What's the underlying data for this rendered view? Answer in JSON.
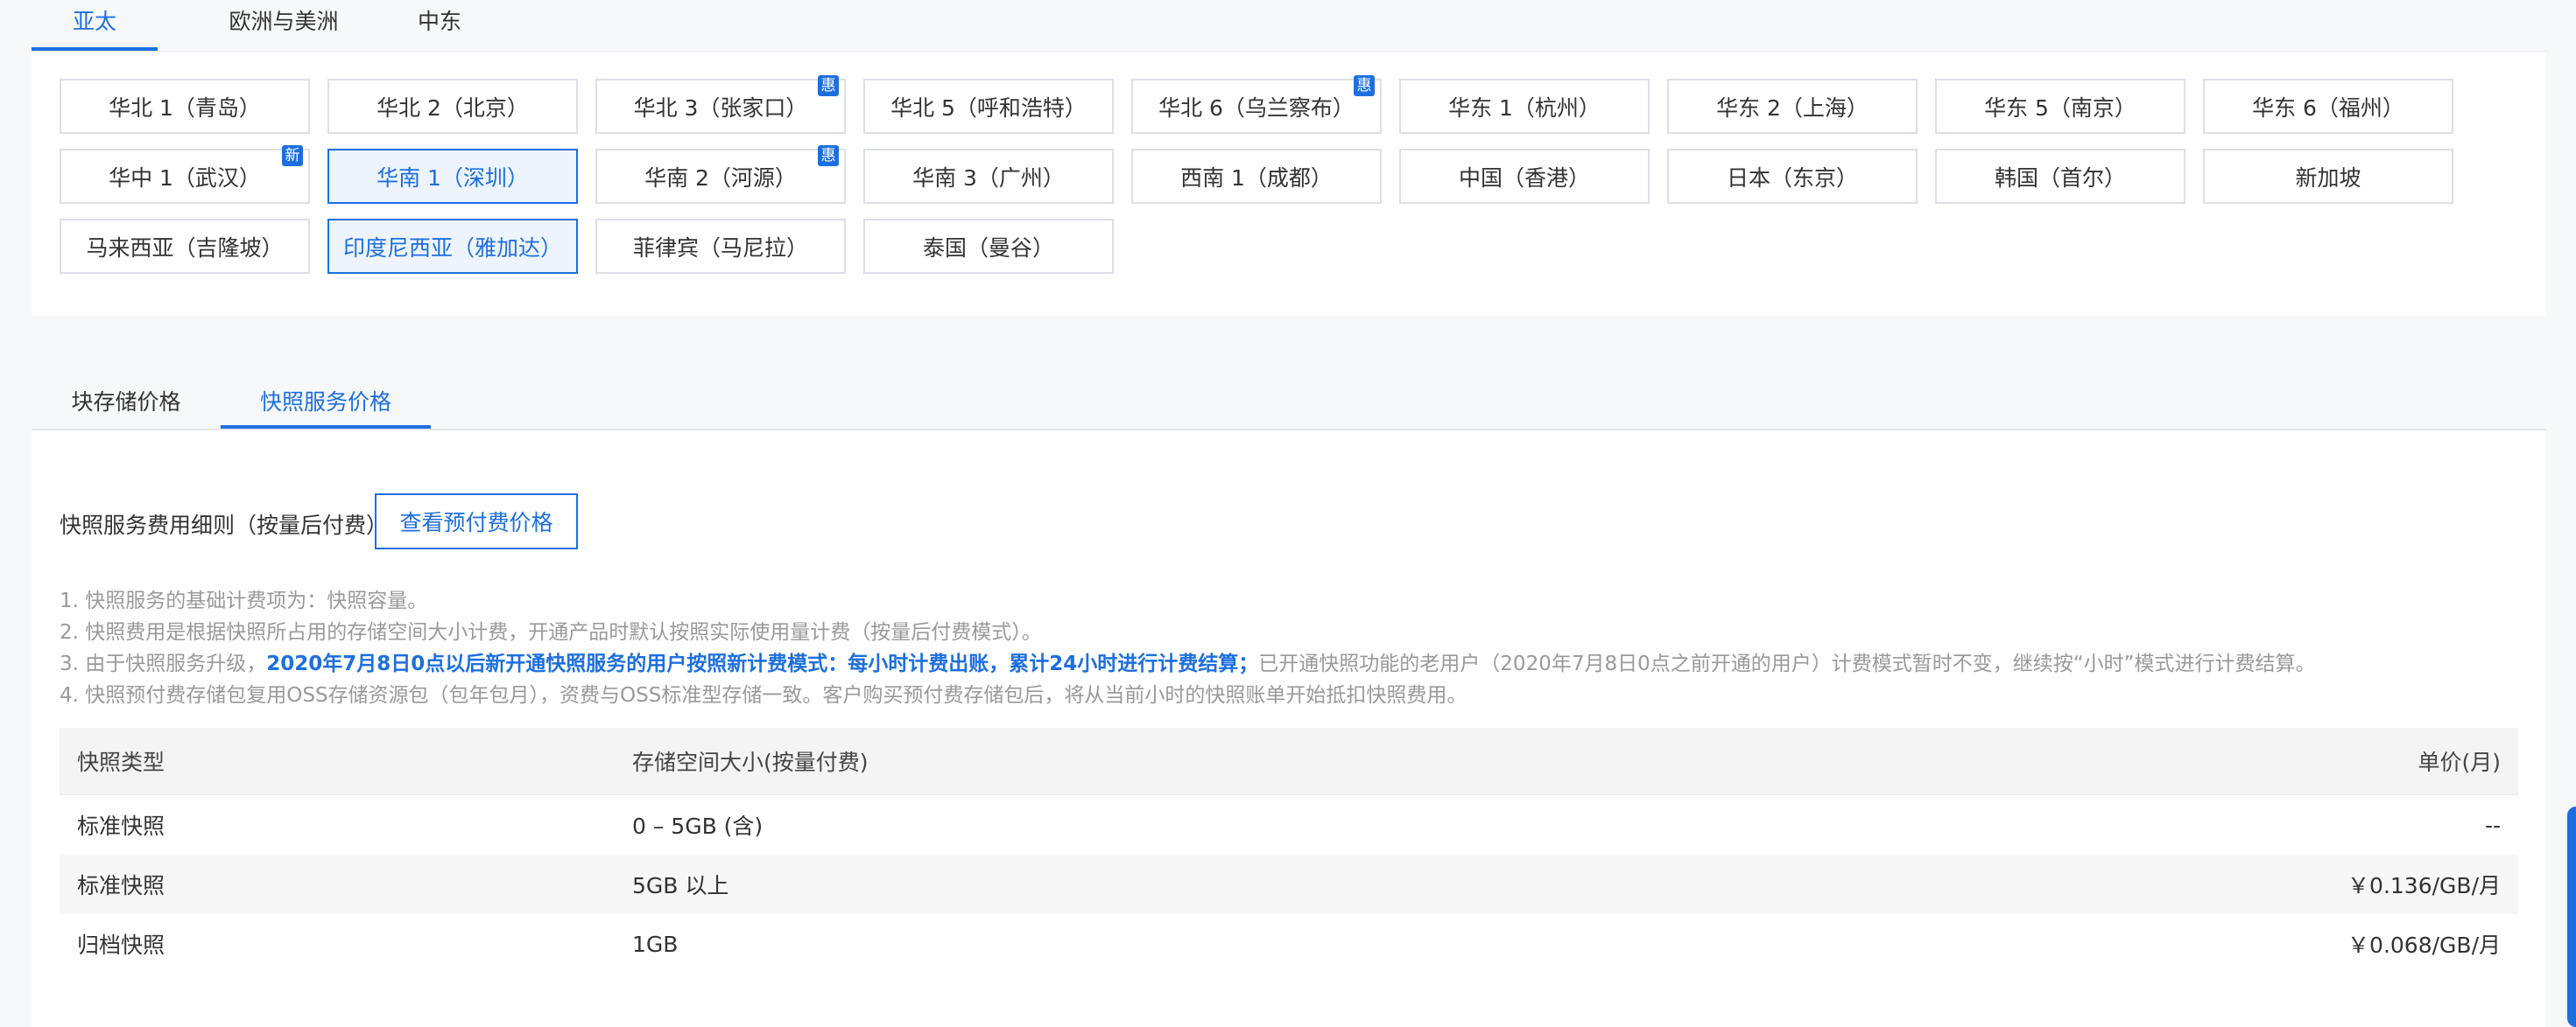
{
  "region_tabs": [
    {
      "label": "亚太",
      "active": true
    },
    {
      "label": "欧洲与美洲",
      "active": false
    },
    {
      "label": "中东",
      "active": false
    }
  ],
  "regions": [
    {
      "label": "华北 1（青岛）",
      "badge": ""
    },
    {
      "label": "华北 2（北京）",
      "badge": ""
    },
    {
      "label": "华北 3（张家口）",
      "badge": "惠"
    },
    {
      "label": "华北 5（呼和浩特）",
      "badge": ""
    },
    {
      "label": "华北 6（乌兰察布）",
      "badge": "惠"
    },
    {
      "label": "华东 1（杭州）",
      "badge": ""
    },
    {
      "label": "华东 2（上海）",
      "badge": ""
    },
    {
      "label": "华东 5（南京）",
      "badge": ""
    },
    {
      "label": "华东 6（福州）",
      "badge": ""
    },
    {
      "label": "华中 1（武汉）",
      "badge": "新"
    },
    {
      "label": "华南 1（深圳）",
      "badge": "",
      "selected": true
    },
    {
      "label": "华南 2（河源）",
      "badge": "惠"
    },
    {
      "label": "华南 3（广州）",
      "badge": ""
    },
    {
      "label": "西南 1（成都）",
      "badge": ""
    },
    {
      "label": "中国（香港）",
      "badge": ""
    },
    {
      "label": "日本（东京）",
      "badge": ""
    },
    {
      "label": "韩国（首尔）",
      "badge": ""
    },
    {
      "label": "新加坡",
      "badge": ""
    },
    {
      "label": "马来西亚（吉隆坡）",
      "badge": ""
    },
    {
      "label": "印度尼西亚（雅加达）",
      "badge": "",
      "selected": true
    },
    {
      "label": "菲律宾（马尼拉）",
      "badge": ""
    },
    {
      "label": "泰国（曼谷）",
      "badge": ""
    }
  ],
  "price_tabs": [
    {
      "label": "块存储价格",
      "active": false
    },
    {
      "label": "快照服务价格",
      "active": true
    }
  ],
  "detail": {
    "label": "快照服务费用细则（按量后付费）",
    "prepaid_button": "查看预付费价格"
  },
  "notes": {
    "n1": "1. 快照服务的基础计费项为：快照容量。",
    "n2": "2. 快照费用是根据快照所占用的存储空间大小计费，开通产品时默认按照实际使用量计费（按量后付费模式）。",
    "n3_prefix": "3. 由于快照服务升级，",
    "n3_highlight": "2020年7月8日0点以后新开通快照服务的用户按照新计费模式：每小时计费出账，累计24小时进行计费结算；",
    "n3_suffix": "已开通快照功能的老用户（2020年7月8日0点之前开通的用户）计费模式暂时不变，继续按“小时”模式进行计费结算。",
    "n4": "4. 快照预付费存储包复用OSS存储资源包（包年包月），资费与OSS标准型存储一致。客户购买预付费存储包后，将从当前小时的快照账单开始抵扣快照费用。"
  },
  "table": {
    "headers": [
      "快照类型",
      "存储空间大小(按量付费)",
      "单价(月)"
    ],
    "rows": [
      [
        "标准快照",
        "0 – 5GB (含)",
        "--"
      ],
      [
        "标准快照",
        "5GB 以上",
        "￥0.136/GB/月"
      ],
      [
        "归档快照",
        "1GB",
        "￥0.068/GB/月"
      ]
    ]
  },
  "colors": {
    "accent": "#1d6fe0",
    "muted_text": "#999999",
    "border": "#dcdfe6"
  }
}
